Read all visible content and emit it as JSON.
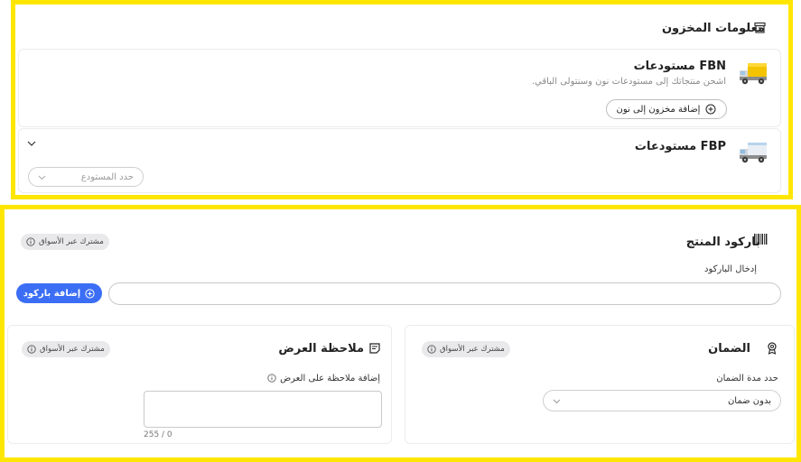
{
  "inventory": {
    "section_title": "معلومات المخزون",
    "fbn": {
      "title": "مستودعات FBN",
      "description": "اشحن منتجاتك إلى مستودعات نون وسنتولى الباقي.",
      "add_button": "إضافة مخزون إلى نون"
    },
    "fbp": {
      "title": "مستودعات FBP",
      "warehouse_placeholder": "حدد المستودع"
    }
  },
  "barcode": {
    "title": "باركود المنتج",
    "shared_badge": "مشترك عبر الأسواق",
    "input_label": "إدخال الباركود",
    "input_value": "",
    "add_button": "إضافة باركود"
  },
  "warranty": {
    "title": "الضمان",
    "shared_badge": "مشترك عبر الأسواق",
    "duration_label": "حدد مدة الضمان",
    "duration_value": "بدون ضمان"
  },
  "offer_note": {
    "title": "ملاحظة العرض",
    "shared_badge": "مشترك عبر الأسواق",
    "input_label": "إضافة ملاحظة على العرض",
    "char_counter": "255 / 0"
  },
  "colors": {
    "highlight": "#ffe600",
    "primary": "#3b6ef5",
    "badge_bg": "#e9e9ec"
  }
}
